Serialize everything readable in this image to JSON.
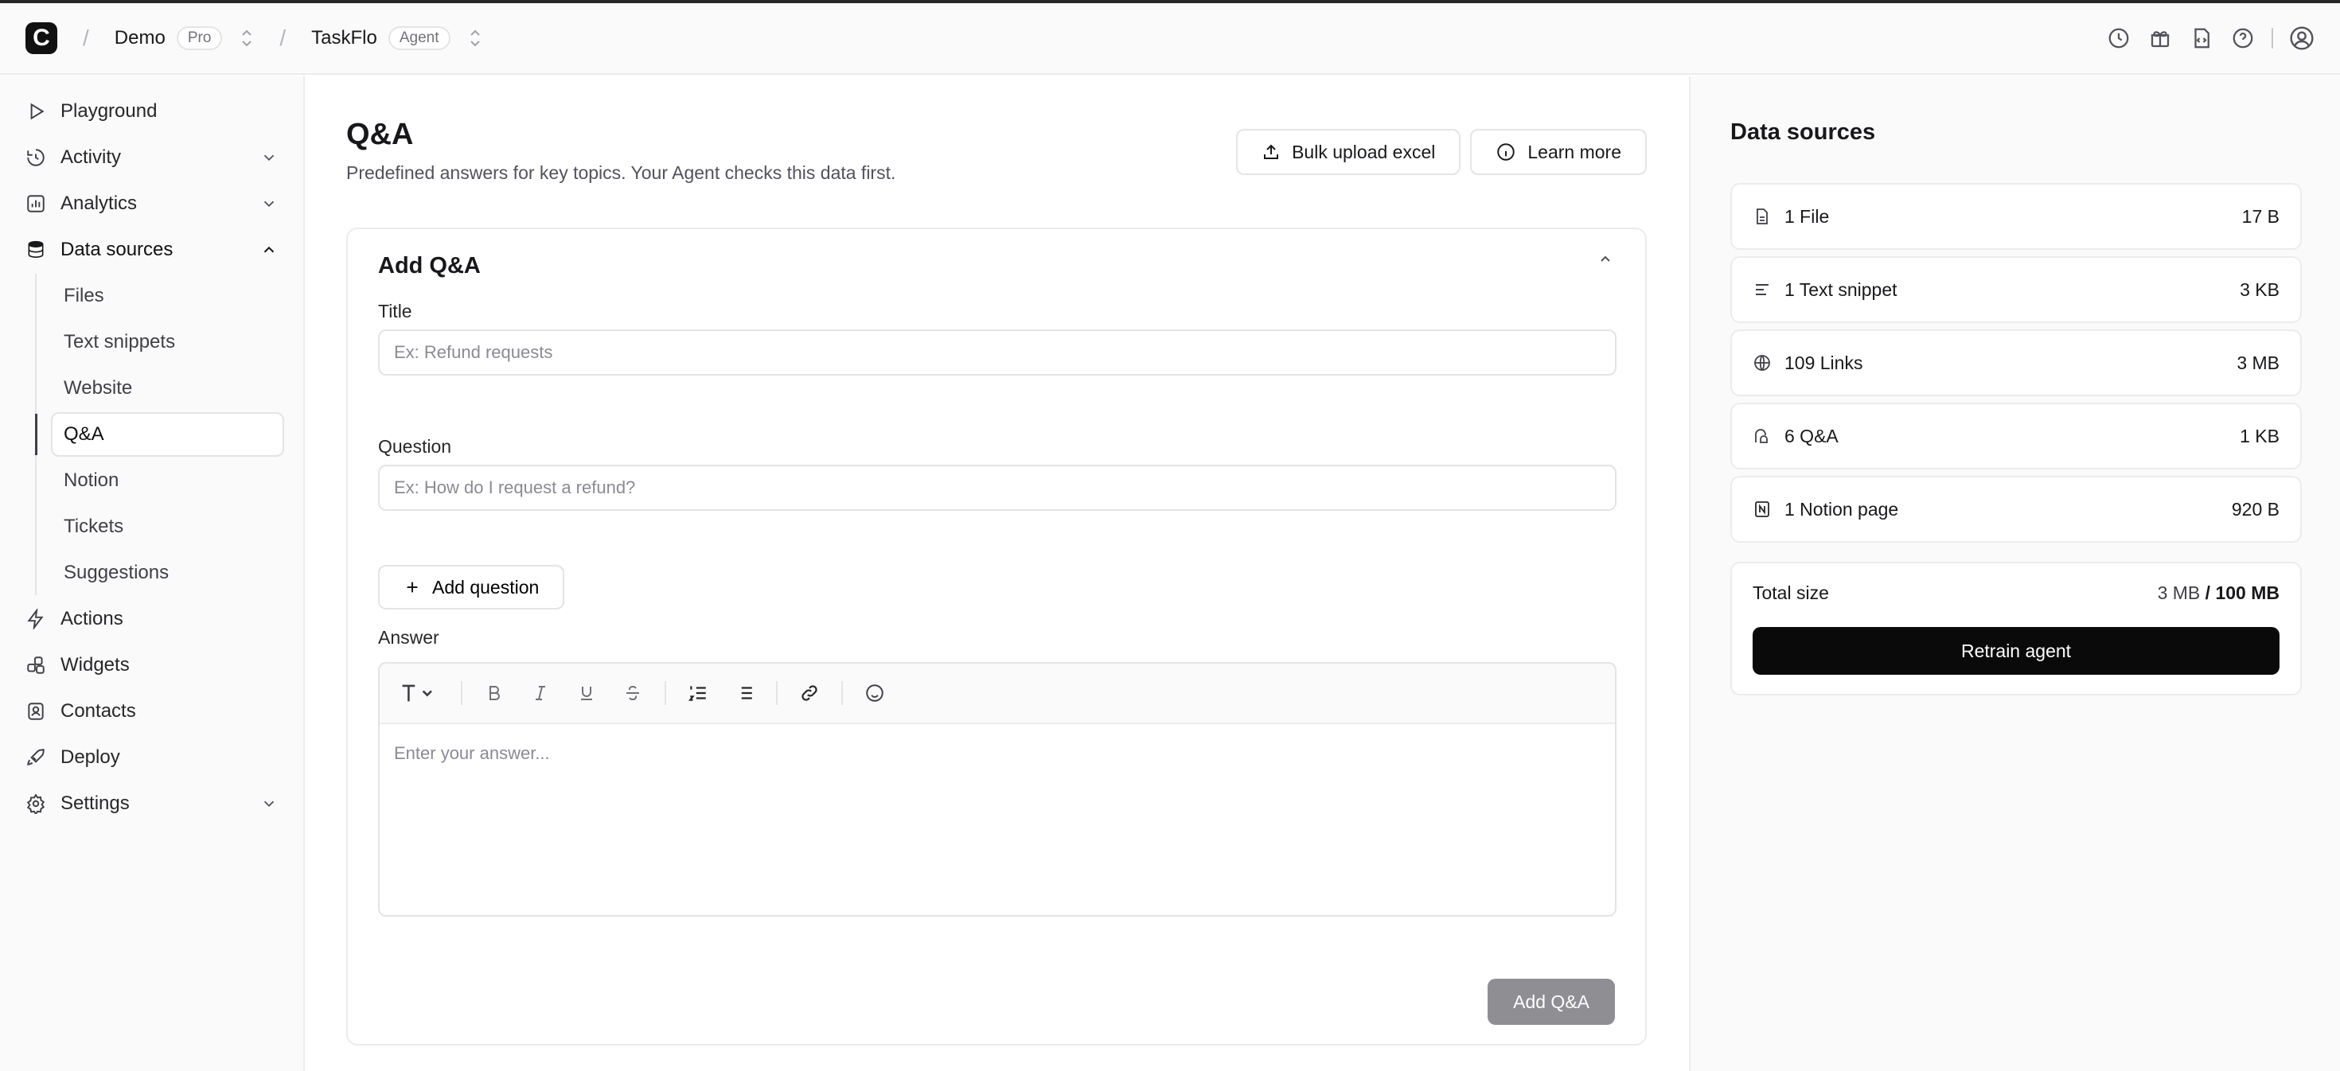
{
  "header": {
    "logo_letter": "C",
    "workspace": {
      "name": "Demo",
      "badge": "Pro"
    },
    "project": {
      "name": "TaskFlo",
      "badge": "Agent"
    }
  },
  "sidebar": {
    "items": [
      {
        "label": "Playground",
        "icon": "play-icon"
      },
      {
        "label": "Activity",
        "icon": "activity-icon"
      },
      {
        "label": "Analytics",
        "icon": "chart-icon"
      },
      {
        "label": "Data sources",
        "icon": "database-icon"
      },
      {
        "label": "Actions",
        "icon": "zap-icon"
      },
      {
        "label": "Widgets",
        "icon": "widgets-icon"
      },
      {
        "label": "Contacts",
        "icon": "contacts-icon"
      },
      {
        "label": "Deploy",
        "icon": "rocket-icon"
      },
      {
        "label": "Settings",
        "icon": "gear-icon"
      }
    ],
    "data_sources_sub": [
      "Files",
      "Text snippets",
      "Website",
      "Q&A",
      "Notion",
      "Tickets",
      "Suggestions"
    ]
  },
  "main": {
    "title": "Q&A",
    "subtitle": "Predefined answers for key topics. Your Agent checks this data first.",
    "bulk_upload_label": "Bulk upload excel",
    "learn_more_label": "Learn more",
    "form": {
      "card_title": "Add Q&A",
      "title_label": "Title",
      "title_placeholder": "Ex: Refund requests",
      "question_label": "Question",
      "question_placeholder": "Ex: How do I request a refund?",
      "add_question_label": "Add question",
      "answer_label": "Answer",
      "answer_placeholder": "Enter your answer...",
      "submit_label": "Add Q&A"
    }
  },
  "right_panel": {
    "title": "Data sources",
    "sources": [
      {
        "label": "1 File",
        "size": "17 B",
        "icon": "file-icon"
      },
      {
        "label": "1 Text snippet",
        "size": "3 KB",
        "icon": "text-lines-icon"
      },
      {
        "label": "109 Links",
        "size": "3 MB",
        "icon": "globe-icon"
      },
      {
        "label": "6 Q&A",
        "size": "1 KB",
        "icon": "qa-chat-icon"
      },
      {
        "label": "1 Notion page",
        "size": "920 B",
        "icon": "notion-icon"
      }
    ],
    "total_label": "Total size",
    "total_used": "3 MB",
    "total_separator": " / ",
    "total_limit": "100 MB",
    "retrain_label": "Retrain agent"
  }
}
